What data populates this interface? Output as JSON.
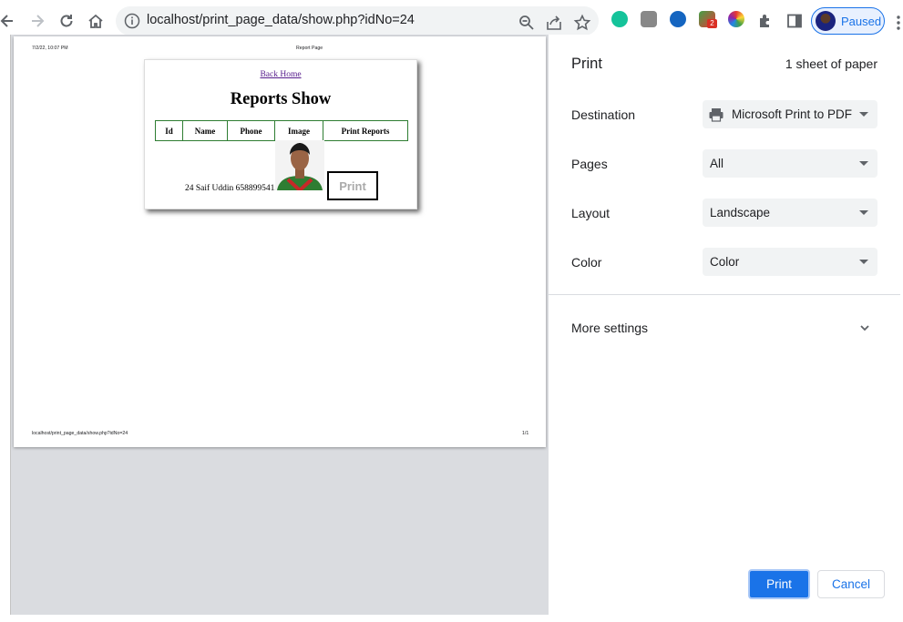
{
  "browser": {
    "url": "localhost/print_page_data/show.php?idNo=24",
    "profile_label": "Paused",
    "ext_badge": "2"
  },
  "preview": {
    "header_left": "7/2/22, 10:07 PM",
    "header_center": "Report Page",
    "footer_left": "localhost/print_page_data/show.php?idNo=24",
    "footer_right": "1/1",
    "page": {
      "back_home": "Back Home",
      "title": "Reports Show",
      "columns": [
        "Id",
        "Name",
        "Phone",
        "Image",
        "Print Reports"
      ],
      "row": "24 Saif Uddin 6588995413",
      "print_button": "Print"
    }
  },
  "panel": {
    "title": "Print",
    "sheet_count": "1 sheet of paper",
    "destination": {
      "label": "Destination",
      "value": "Microsoft Print to PDF"
    },
    "pages": {
      "label": "Pages",
      "value": "All"
    },
    "layout": {
      "label": "Layout",
      "value": "Landscape"
    },
    "color": {
      "label": "Color",
      "value": "Color"
    },
    "more_settings": "More settings",
    "print_button": "Print",
    "cancel_button": "Cancel"
  },
  "colors": {
    "accent": "#1a73e8",
    "table_border": "#2e7d32",
    "link": "#551a8b"
  }
}
